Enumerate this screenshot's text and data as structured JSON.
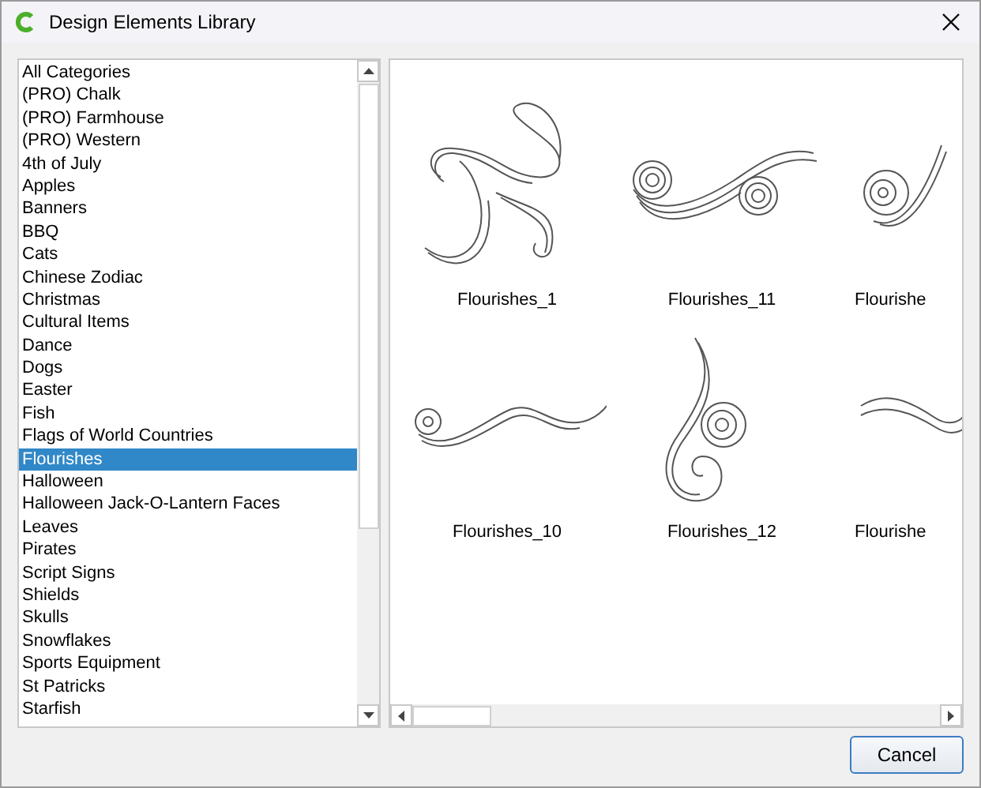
{
  "window": {
    "title": "Design Elements Library"
  },
  "categories": [
    {
      "label": "All Categories",
      "selected": false
    },
    {
      "label": "(PRO) Chalk",
      "selected": false
    },
    {
      "label": "(PRO) Farmhouse",
      "selected": false
    },
    {
      "label": "(PRO) Western",
      "selected": false
    },
    {
      "label": "4th of July",
      "selected": false
    },
    {
      "label": "Apples",
      "selected": false
    },
    {
      "label": "Banners",
      "selected": false
    },
    {
      "label": "BBQ",
      "selected": false
    },
    {
      "label": "Cats",
      "selected": false
    },
    {
      "label": "Chinese Zodiac",
      "selected": false
    },
    {
      "label": "Christmas",
      "selected": false
    },
    {
      "label": "Cultural Items",
      "selected": false
    },
    {
      "label": "Dance",
      "selected": false
    },
    {
      "label": "Dogs",
      "selected": false
    },
    {
      "label": "Easter",
      "selected": false
    },
    {
      "label": "Fish",
      "selected": false
    },
    {
      "label": "Flags of World Countries",
      "selected": false
    },
    {
      "label": "Flourishes",
      "selected": true
    },
    {
      "label": "Halloween",
      "selected": false
    },
    {
      "label": "Halloween Jack-O-Lantern Faces",
      "selected": false
    },
    {
      "label": "Leaves",
      "selected": false
    },
    {
      "label": "Pirates",
      "selected": false
    },
    {
      "label": "Script Signs",
      "selected": false
    },
    {
      "label": "Shields",
      "selected": false
    },
    {
      "label": "Skulls",
      "selected": false
    },
    {
      "label": "Snowflakes",
      "selected": false
    },
    {
      "label": "Sports Equipment",
      "selected": false
    },
    {
      "label": "St Patricks",
      "selected": false
    },
    {
      "label": "Starfish",
      "selected": false
    }
  ],
  "elements": [
    {
      "label": "Flourishes_1",
      "kind": "scroll"
    },
    {
      "label": "Flourishes_11",
      "kind": "wave"
    },
    {
      "label": "Flourishe",
      "kind": "curl"
    },
    {
      "label": "Flourishes_10",
      "kind": "line"
    },
    {
      "label": "Flourishes_12",
      "kind": "drop"
    },
    {
      "label": "Flourishe",
      "kind": "ribbon"
    }
  ],
  "buttons": [
    "Cancel"
  ]
}
